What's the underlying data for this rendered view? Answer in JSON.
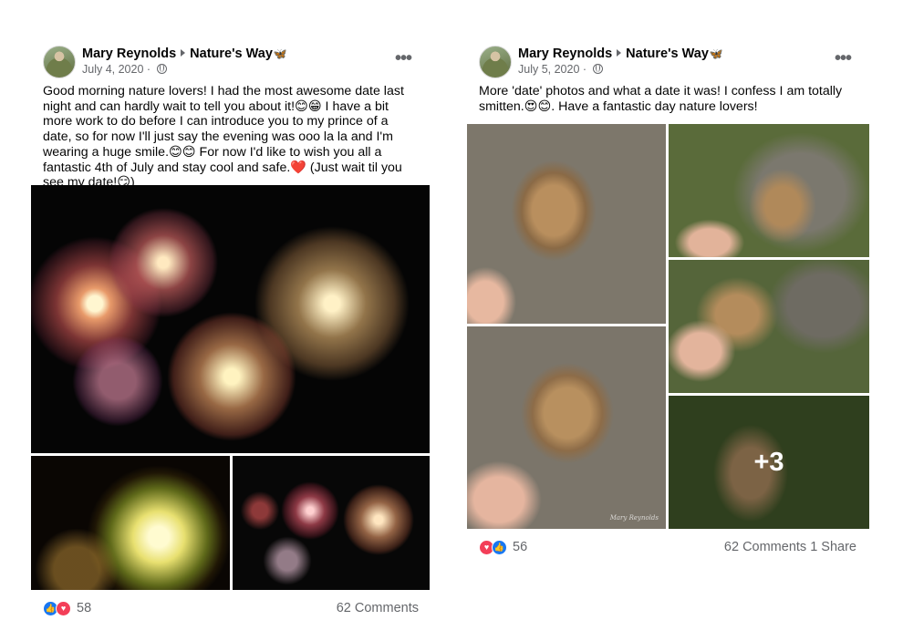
{
  "posts": [
    {
      "author": "Mary Reynolds",
      "group": "Nature's Way",
      "group_emoji": "🦋",
      "date": "July 4, 2020",
      "text": "Good morning nature lovers! I had the most awesome date last night and can hardly wait to tell you about it!😊😁 I have a bit more work to do before I can introduce you to my prince of a date, so for now I'll just say the evening was ooo la la and I'm wearing a huge smile.😊😊 For now I'd like to wish you all a fantastic 4th of July and stay cool and safe.❤️ (Just wait til you see my date!😏)",
      "reactions": [
        "like",
        "love"
      ],
      "reaction_count": "58",
      "comments": "62 Comments",
      "shares": ""
    },
    {
      "author": "Mary Reynolds",
      "group": "Nature's Way",
      "group_emoji": "🦋",
      "date": "July 5, 2020",
      "text": "More 'date' photos and what a date it was! I confess I am totally smitten.😍😊. Have a fantastic day nature lovers!",
      "reactions": [
        "love",
        "like"
      ],
      "reaction_count": "56",
      "comments": "62 Comments",
      "shares": "1 Share",
      "more_photos": "+3",
      "watermark": "Mary Reynolds"
    }
  ],
  "icons": {
    "more": "more-options-icon",
    "privacy": "globe-icon",
    "like": "like-reaction-icon",
    "love": "love-reaction-icon"
  },
  "colors": {
    "like_blue": "#1877f2",
    "love_red": "#f33e58",
    "meta_gray": "#65676b"
  }
}
